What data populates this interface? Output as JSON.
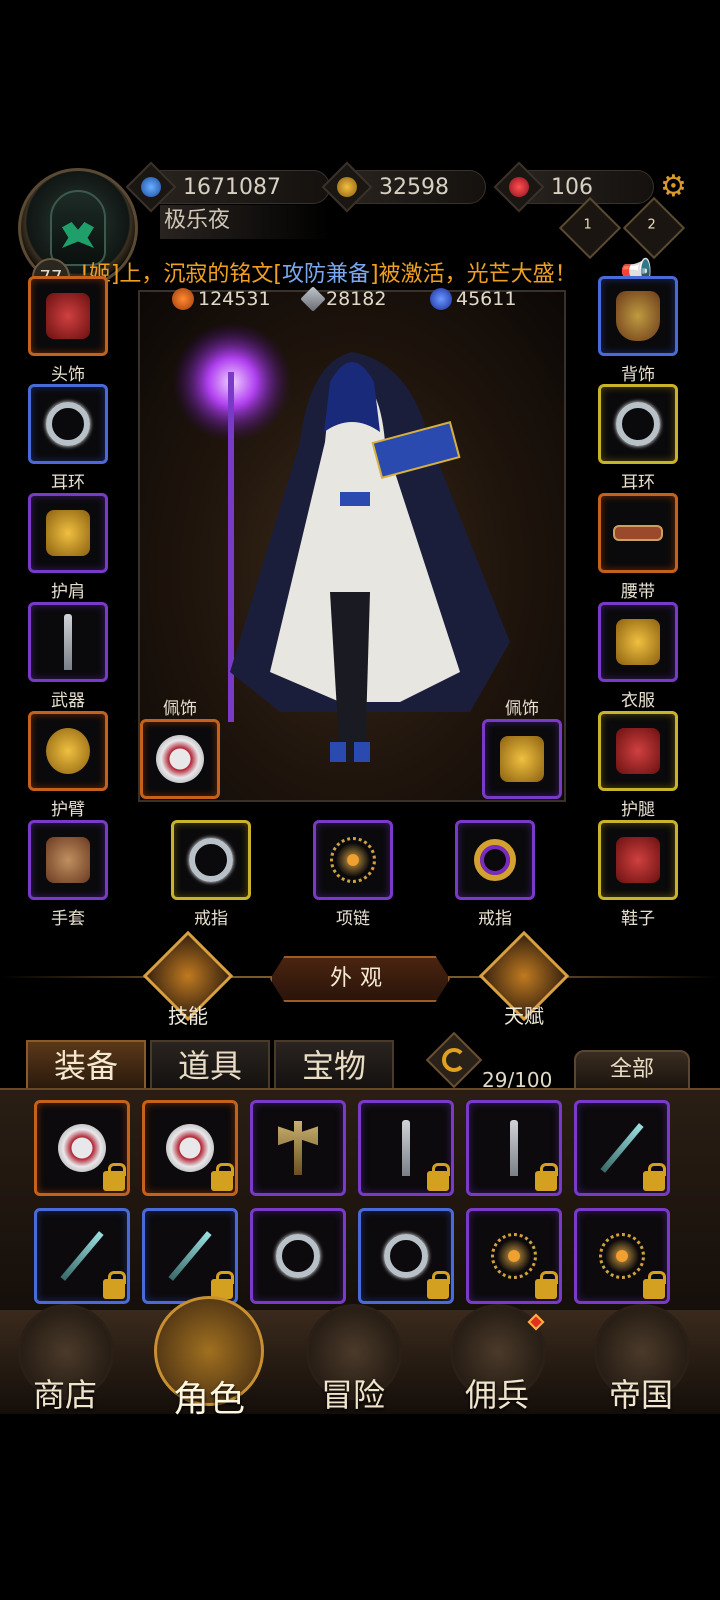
{
  "player": {
    "name": "极乐夜",
    "level": "77"
  },
  "resources": {
    "gems": "1671087",
    "gold": "32598",
    "rubies": "106"
  },
  "ranks": [
    "1",
    "2"
  ],
  "announcement": {
    "part1": "!姬]上，沉寂的铭文[",
    "highlight": "攻防兼备",
    "part2": "]被激活，光芒大盛！"
  },
  "stats": {
    "hp": "124531",
    "attack": "28182",
    "mana": "45611"
  },
  "equipment_slots": {
    "head": "头饰",
    "back": "背饰",
    "earring_left": "耳环",
    "earring_right": "耳环",
    "shoulder": "护肩",
    "belt": "腰带",
    "weapon": "武器",
    "clothes": "衣服",
    "bracer": "护臂",
    "leggings": "护腿",
    "pendant_left": "佩饰",
    "pendant_right": "佩饰",
    "gloves": "手套",
    "ring_left": "戒指",
    "necklace": "项链",
    "ring_right": "戒指",
    "shoes": "鞋子"
  },
  "actions": {
    "skills": "技能",
    "appearance": "外观",
    "talent": "天赋"
  },
  "tabs": [
    "装备",
    "道具",
    "宝物"
  ],
  "inventory": {
    "capacity": "29/100",
    "filter": "全部"
  },
  "nav": [
    "商店",
    "角色",
    "冒险",
    "佣兵",
    "帝国"
  ],
  "colors": {
    "quality_orange": "#c4621c",
    "quality_purple": "#7a3ac8",
    "quality_blue": "#4a6ad8",
    "quality_yellow": "#c8b42a",
    "announcement": "#f0a020",
    "announcement_highlight": "#7aa8f0"
  }
}
